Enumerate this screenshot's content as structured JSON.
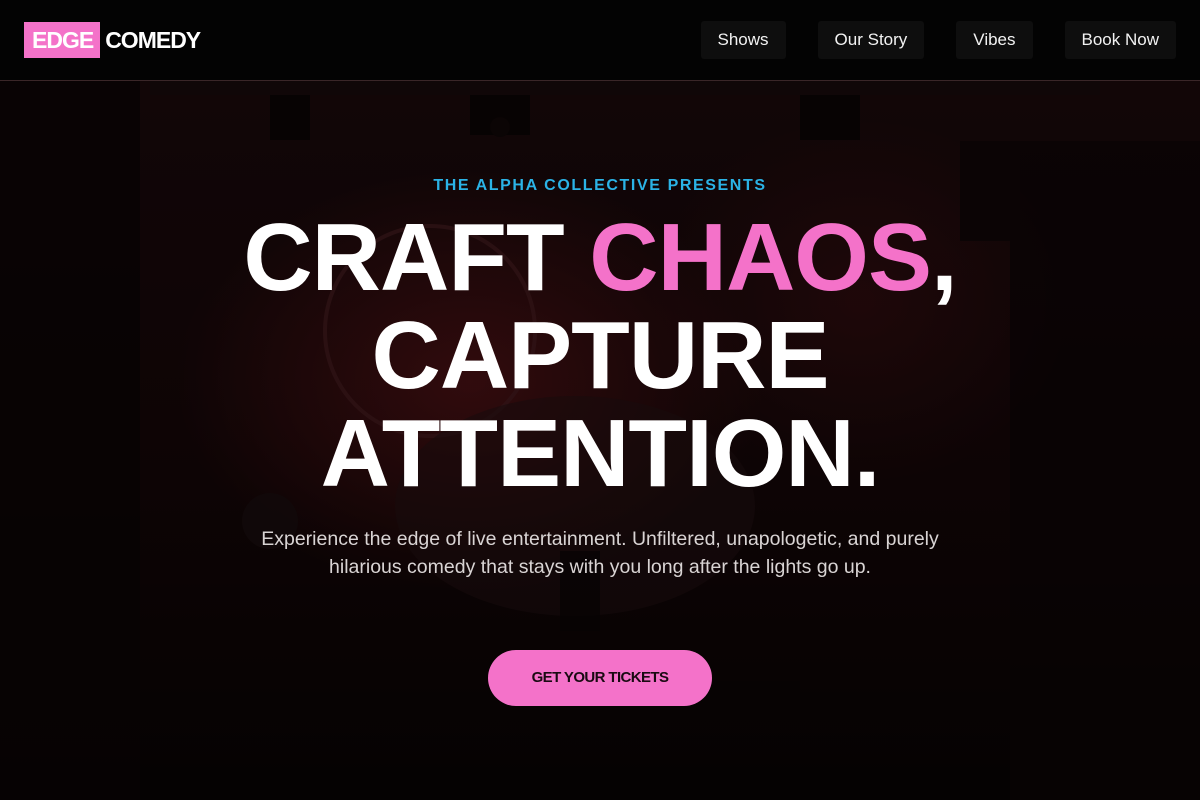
{
  "brand": {
    "part1": "EDGE",
    "part2": "COMEDY"
  },
  "nav": {
    "items": [
      "Shows",
      "Our Story",
      "Vibes",
      "Book Now"
    ]
  },
  "hero": {
    "eyebrow": "THE ALPHA COLLECTIVE PRESENTS",
    "headline": {
      "line1_a": "CRAFT ",
      "line1_highlight": "CHAOS",
      "line1_b": ",",
      "line2": "CAPTURE",
      "line3": "ATTENTION."
    },
    "subtitle": "Experience the edge of live entertainment. Unfiltered, unapologetic, and purely hilarious comedy that stays with you long after the lights go up.",
    "cta_label": "GET YOUR TICKETS"
  },
  "colors": {
    "accent_pink": "#f472c9",
    "accent_blue": "#2bb3e6",
    "background": "#0a0506"
  }
}
